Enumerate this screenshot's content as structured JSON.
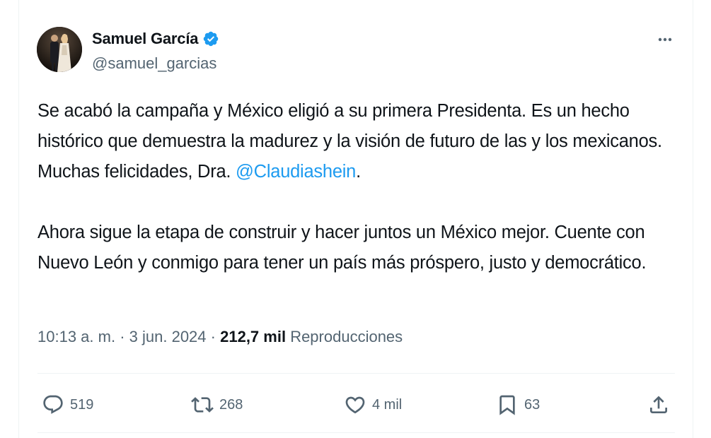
{
  "author": {
    "name": "Samuel García",
    "handle": "@samuel_garcias",
    "verified": true
  },
  "tweet": {
    "paragraph1_text": "Se acabó la campaña y México eligió a su primera Presidenta. Es un hecho histórico que demuestra la madurez y la visión de futuro de las y los mexicanos. Muchas felicidades, Dra. ",
    "paragraph1_mention": "@Claudiashein",
    "paragraph1_end": ".",
    "paragraph2": "Ahora sigue la etapa de construir y hacer juntos un México mejor. Cuente con Nuevo León y conmigo para tener un país más próspero, justo y democrático."
  },
  "meta": {
    "time": "10:13 a. m.",
    "separator": "·",
    "date": "3 jun. 2024",
    "views_count": "212,7 mil",
    "views_label": "Reproducciones"
  },
  "actions": {
    "replies": "519",
    "reposts": "268",
    "likes": "4 mil",
    "bookmarks": "63"
  },
  "colors": {
    "accent": "#1d9bf0",
    "secondary_text": "#536471",
    "primary_text": "#0f1419",
    "divider": "#eff3f4"
  },
  "icons": {
    "more": "more-horizontal-icon",
    "verified": "verified-badge-icon",
    "reply": "reply-bubble-icon",
    "repost": "repost-arrows-icon",
    "like": "heart-icon",
    "bookmark": "bookmark-icon",
    "share": "share-upload-icon"
  }
}
